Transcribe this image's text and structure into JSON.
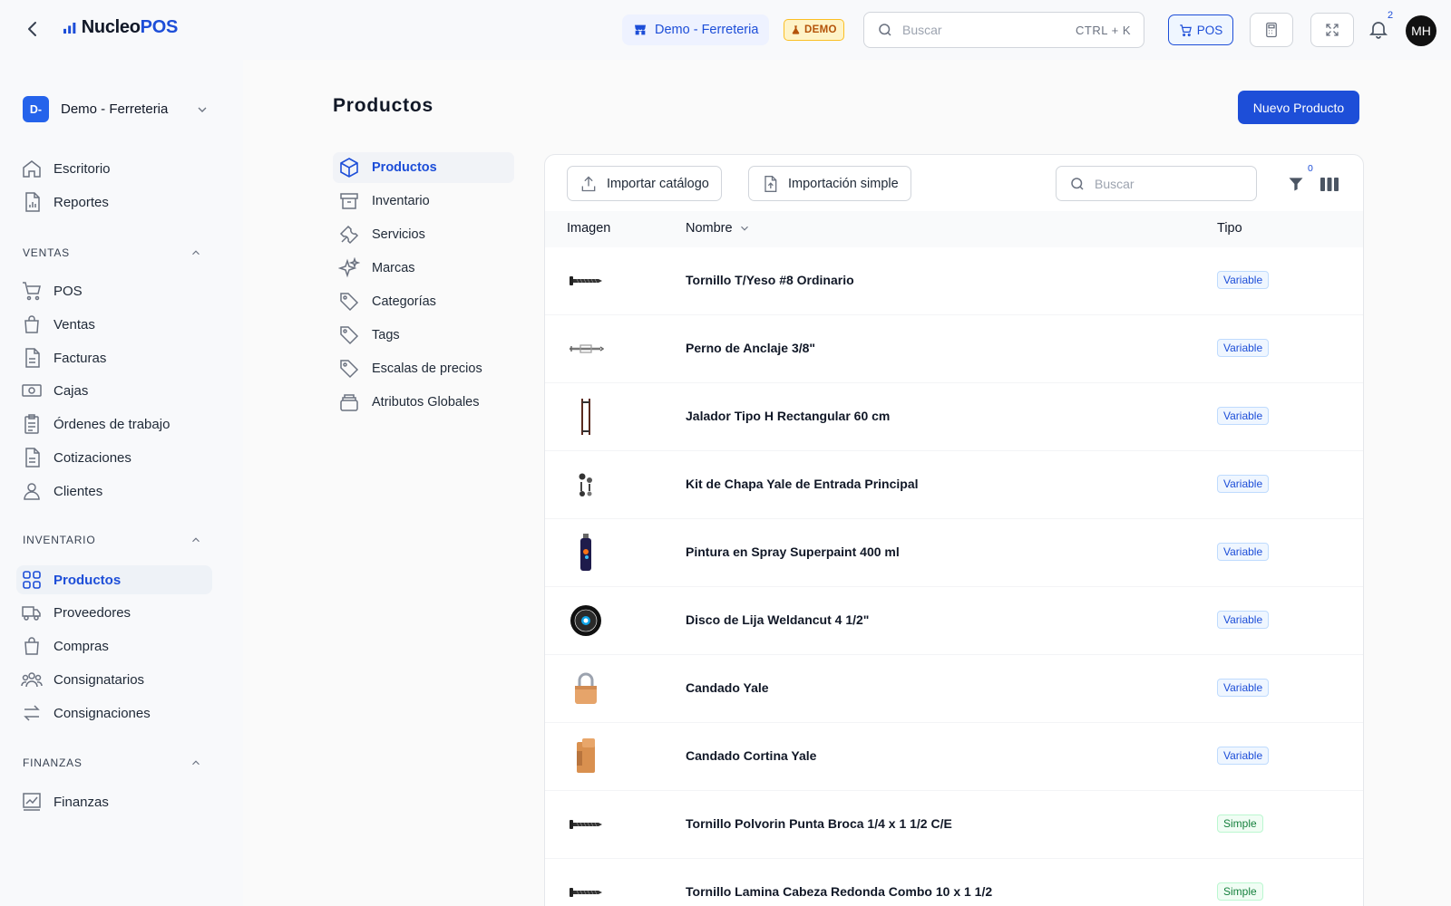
{
  "app": {
    "logo_text_a": "Nucleo",
    "logo_text_b": "POS",
    "store_name": "Demo - Ferreteria",
    "demo_badge": "DEMO",
    "search_placeholder": "Buscar",
    "search_shortcut": "CTRL + K",
    "pos_label": "POS",
    "notification_count": "2",
    "avatar_initials": "MH"
  },
  "sidebar": {
    "org_initials": "D-",
    "org_name": "Demo - Ferreteria",
    "top_items": [
      {
        "label": "Escritorio",
        "icon": "home-icon"
      },
      {
        "label": "Reportes",
        "icon": "report-icon"
      }
    ],
    "sections": [
      {
        "title": "VENTAS",
        "items": [
          {
            "label": "POS",
            "icon": "cart-icon"
          },
          {
            "label": "Ventas",
            "icon": "bag-icon"
          },
          {
            "label": "Facturas",
            "icon": "document-icon"
          },
          {
            "label": "Cajas",
            "icon": "cash-icon"
          },
          {
            "label": "Órdenes de trabajo",
            "icon": "clipboard-icon"
          },
          {
            "label": "Cotizaciones",
            "icon": "document-icon"
          },
          {
            "label": "Clientes",
            "icon": "user-icon"
          }
        ]
      },
      {
        "title": "INVENTARIO",
        "items": [
          {
            "label": "Productos",
            "icon": "grid-icon",
            "active": true
          },
          {
            "label": "Proveedores",
            "icon": "truck-icon"
          },
          {
            "label": "Compras",
            "icon": "bag-icon"
          },
          {
            "label": "Consignatarios",
            "icon": "users-icon"
          },
          {
            "label": "Consignaciones",
            "icon": "arrows-icon"
          }
        ]
      },
      {
        "title": "FINANZAS",
        "items": [
          {
            "label": "Finanzas",
            "icon": "chart-icon"
          }
        ]
      }
    ]
  },
  "page": {
    "title": "Productos",
    "new_button": "Nuevo Producto"
  },
  "sub_nav": [
    {
      "label": "Productos",
      "icon": "cube-icon",
      "active": true
    },
    {
      "label": "Inventario",
      "icon": "archive-icon"
    },
    {
      "label": "Servicios",
      "icon": "tools-icon"
    },
    {
      "label": "Marcas",
      "icon": "sparkles-icon"
    },
    {
      "label": "Categorías",
      "icon": "tag-icon"
    },
    {
      "label": "Tags",
      "icon": "tag-icon"
    },
    {
      "label": "Escalas de precios",
      "icon": "tag-icon"
    },
    {
      "label": "Atributos Globales",
      "icon": "stack-icon"
    }
  ],
  "table": {
    "import_catalog": "Importar catálogo",
    "import_simple": "Importación simple",
    "search_placeholder": "Buscar",
    "filter_count": "0",
    "columns": {
      "image": "Imagen",
      "name": "Nombre",
      "type": "Tipo"
    },
    "rows": [
      {
        "name": "Tornillo T/Yeso #8 Ordinario",
        "type": "Variable",
        "thumb": "screw"
      },
      {
        "name": "Perno de Anclaje 3/8\"",
        "type": "Variable",
        "thumb": "anchor"
      },
      {
        "name": "Jalador Tipo H Rectangular 60 cm",
        "type": "Variable",
        "thumb": "handle"
      },
      {
        "name": "Kit de Chapa Yale de Entrada Principal",
        "type": "Variable",
        "thumb": "lockset"
      },
      {
        "name": "Pintura en Spray Superpaint 400 ml",
        "type": "Variable",
        "thumb": "spray"
      },
      {
        "name": "Disco de Lija Weldancut 4 1/2\"",
        "type": "Variable",
        "thumb": "disc"
      },
      {
        "name": "Candado Yale",
        "type": "Variable",
        "thumb": "padlock"
      },
      {
        "name": "Candado Cortina Yale",
        "type": "Variable",
        "thumb": "shutter-lock"
      },
      {
        "name": "Tornillo Polvorin Punta Broca 1/4 x 1 1/2 C/E",
        "type": "Simple",
        "thumb": "screw"
      },
      {
        "name": "Tornillo Lamina Cabeza Redonda Combo 10 x 1 1/2",
        "type": "Simple",
        "thumb": "screw"
      }
    ]
  }
}
